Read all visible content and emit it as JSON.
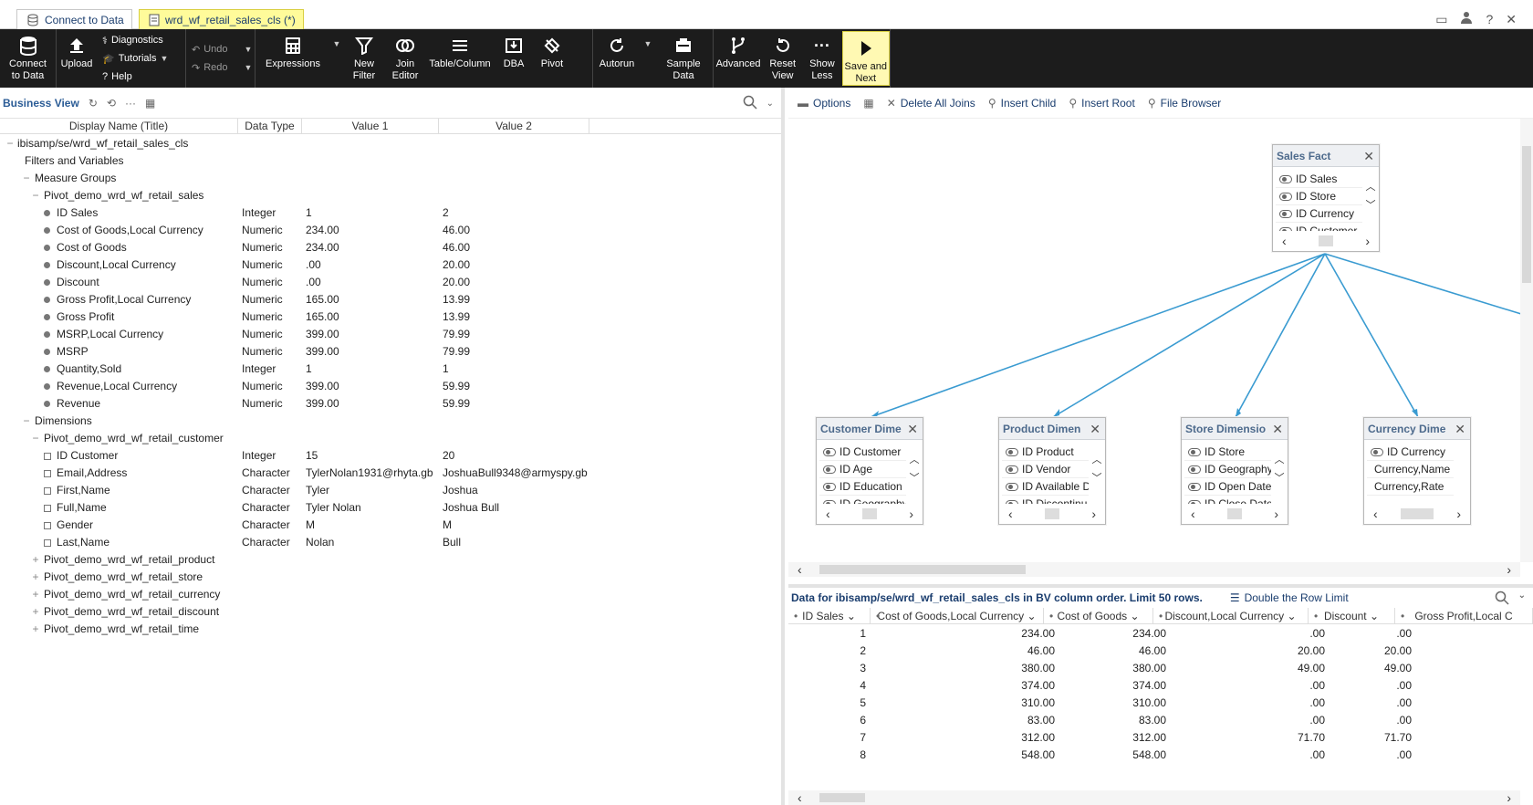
{
  "tabs": [
    {
      "label": "Connect to Data",
      "icon": "database-icon"
    },
    {
      "label": "wrd_wf_retail_sales_cls (*)",
      "icon": "document-icon"
    }
  ],
  "topright_icons": [
    "window-icon",
    "user-icon",
    "help-icon",
    "close-icon"
  ],
  "ribbon": {
    "connect": "Connect to Data",
    "upload": "Upload",
    "diagnostics": "Diagnostics",
    "tutorials": "Tutorials",
    "help": "Help",
    "undo": "Undo",
    "redo": "Redo",
    "expressions": "Expressions",
    "new_filter": "New Filter",
    "join_editor": "Join Editor",
    "table_column": "Table/Column",
    "dba": "DBA",
    "pivot": "Pivot",
    "autorun": "Autorun",
    "sample_data": "Sample Data",
    "advanced": "Advanced",
    "reset_view": "Reset View",
    "show_less": "Show Less",
    "save_next": "Save and Next"
  },
  "business_view": {
    "title": "Business View",
    "columns": [
      "Display Name (Title)",
      "Data Type",
      "Value 1",
      "Value 2"
    ],
    "rows": [
      {
        "indent": 0,
        "kind": "expanded",
        "label": "ibisamp/se/wrd_wf_retail_sales_cls"
      },
      {
        "indent": 1,
        "kind": "none",
        "label": "Filters and Variables"
      },
      {
        "indent": 1,
        "kind": "expanded",
        "label": "Measure Groups"
      },
      {
        "indent": 2,
        "kind": "expanded",
        "label": "Pivot_demo_wrd_wf_retail_sales"
      },
      {
        "indent": 3,
        "kind": "measure",
        "label": "ID Sales",
        "type": "Integer",
        "v1": "1",
        "v2": "2"
      },
      {
        "indent": 3,
        "kind": "measure",
        "label": "Cost of Goods,Local Currency",
        "type": "Numeric",
        "v1": "234.00",
        "v2": "46.00"
      },
      {
        "indent": 3,
        "kind": "measure",
        "label": "Cost of Goods",
        "type": "Numeric",
        "v1": "234.00",
        "v2": "46.00"
      },
      {
        "indent": 3,
        "kind": "measure",
        "label": "Discount,Local Currency",
        "type": "Numeric",
        "v1": ".00",
        "v2": "20.00"
      },
      {
        "indent": 3,
        "kind": "measure",
        "label": "Discount",
        "type": "Numeric",
        "v1": ".00",
        "v2": "20.00"
      },
      {
        "indent": 3,
        "kind": "measure",
        "label": "Gross Profit,Local Currency",
        "type": "Numeric",
        "v1": "165.00",
        "v2": "13.99"
      },
      {
        "indent": 3,
        "kind": "measure",
        "label": "Gross Profit",
        "type": "Numeric",
        "v1": "165.00",
        "v2": "13.99"
      },
      {
        "indent": 3,
        "kind": "measure",
        "label": "MSRP,Local Currency",
        "type": "Numeric",
        "v1": "399.00",
        "v2": "79.99"
      },
      {
        "indent": 3,
        "kind": "measure",
        "label": "MSRP",
        "type": "Numeric",
        "v1": "399.00",
        "v2": "79.99"
      },
      {
        "indent": 3,
        "kind": "measure",
        "label": "Quantity,Sold",
        "type": "Integer",
        "v1": "1",
        "v2": "1"
      },
      {
        "indent": 3,
        "kind": "measure",
        "label": "Revenue,Local Currency",
        "type": "Numeric",
        "v1": "399.00",
        "v2": "59.99"
      },
      {
        "indent": 3,
        "kind": "measure",
        "label": "Revenue",
        "type": "Numeric",
        "v1": "399.00",
        "v2": "59.99"
      },
      {
        "indent": 1,
        "kind": "expanded",
        "label": "Dimensions"
      },
      {
        "indent": 2,
        "kind": "expanded",
        "label": "Pivot_demo_wrd_wf_retail_customer"
      },
      {
        "indent": 3,
        "kind": "dimension",
        "label": "ID Customer",
        "type": "Integer",
        "v1": "15",
        "v2": "20"
      },
      {
        "indent": 3,
        "kind": "dimension",
        "label": "Email,Address",
        "type": "Character",
        "v1": "TylerNolan1931@rhyta.gb",
        "v2": "JoshuaBull9348@armyspy.gb"
      },
      {
        "indent": 3,
        "kind": "dimension",
        "label": "First,Name",
        "type": "Character",
        "v1": "Tyler",
        "v2": "Joshua"
      },
      {
        "indent": 3,
        "kind": "dimension",
        "label": "Full,Name",
        "type": "Character",
        "v1": "Tyler Nolan",
        "v2": "Joshua Bull"
      },
      {
        "indent": 3,
        "kind": "dimension",
        "label": "Gender",
        "type": "Character",
        "v1": "M",
        "v2": "M"
      },
      {
        "indent": 3,
        "kind": "dimension",
        "label": "Last,Name",
        "type": "Character",
        "v1": "Nolan",
        "v2": "Bull"
      },
      {
        "indent": 2,
        "kind": "collapsed",
        "label": "Pivot_demo_wrd_wf_retail_product"
      },
      {
        "indent": 2,
        "kind": "collapsed",
        "label": "Pivot_demo_wrd_wf_retail_store"
      },
      {
        "indent": 2,
        "kind": "collapsed",
        "label": "Pivot_demo_wrd_wf_retail_currency"
      },
      {
        "indent": 2,
        "kind": "collapsed",
        "label": "Pivot_demo_wrd_wf_retail_discount"
      },
      {
        "indent": 2,
        "kind": "collapsed",
        "label": "Pivot_demo_wrd_wf_retail_time"
      }
    ]
  },
  "diagram_toolbar": {
    "options": "Options",
    "delete_joins": "Delete All Joins",
    "insert_child": "Insert Child",
    "insert_root": "Insert Root",
    "file_browser": "File Browser"
  },
  "entities": [
    {
      "id": "sales",
      "title": "Sales Fact",
      "fields": [
        "ID Sales",
        "ID Store",
        "ID Currency",
        "ID Customer"
      ]
    },
    {
      "id": "customer",
      "title": "Customer Dime",
      "fields": [
        "ID Customer",
        "ID Age",
        "ID Education",
        "ID Geography"
      ]
    },
    {
      "id": "product",
      "title": "Product Dimen",
      "fields": [
        "ID Product",
        "ID Vendor",
        "ID Available D",
        "ID Discontinu"
      ]
    },
    {
      "id": "store",
      "title": "Store Dimensio",
      "fields": [
        "ID Store",
        "ID Geography",
        "ID Open Date",
        "ID Close Date"
      ]
    },
    {
      "id": "currency",
      "title": "Currency Dime",
      "fields": [
        "ID Currency",
        "Currency,Name",
        "Currency,Rate"
      ]
    }
  ],
  "data_pane": {
    "title": "Data for ibisamp/se/wrd_wf_retail_sales_cls in BV column order. Limit 50 rows.",
    "double_limit": "Double the Row Limit",
    "columns": [
      "ID Sales",
      "Cost of Goods,Local Currency",
      "Cost of Goods",
      "Discount,Local Currency",
      "Discount",
      "Gross Profit,Local C"
    ],
    "rows": [
      [
        "1",
        "234.00",
        "234.00",
        ".00",
        ".00"
      ],
      [
        "2",
        "46.00",
        "46.00",
        "20.00",
        "20.00"
      ],
      [
        "3",
        "380.00",
        "380.00",
        "49.00",
        "49.00"
      ],
      [
        "4",
        "374.00",
        "374.00",
        ".00",
        ".00"
      ],
      [
        "5",
        "310.00",
        "310.00",
        ".00",
        ".00"
      ],
      [
        "6",
        "83.00",
        "83.00",
        ".00",
        ".00"
      ],
      [
        "7",
        "312.00",
        "312.00",
        "71.70",
        "71.70"
      ],
      [
        "8",
        "548.00",
        "548.00",
        ".00",
        ".00"
      ]
    ]
  }
}
